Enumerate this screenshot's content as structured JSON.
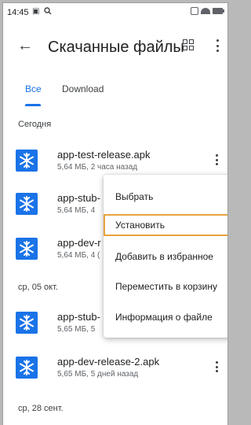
{
  "status_bar": {
    "time": "14:45",
    "left_icons": [
      "gallery-icon",
      "search-icon"
    ],
    "right_icons": [
      "vibrate-icon",
      "wifi-icon",
      "battery-icon"
    ]
  },
  "app_bar": {
    "title": "Скачанные файлы",
    "icons": [
      "back-arrow-icon",
      "grid-view-icon",
      "more-vert-icon"
    ]
  },
  "tabs": [
    {
      "label": "Все",
      "active": true
    },
    {
      "label": "Download",
      "active": false
    }
  ],
  "sections": [
    {
      "label": "Сегодня"
    },
    {
      "label": "ср, 05 окт."
    },
    {
      "label": "ср, 28 сент."
    }
  ],
  "files": [
    {
      "name": "app-test-release.apk",
      "meta": "5,64 МБ, 2 часа назад"
    },
    {
      "name": "app-stub-",
      "meta": "5,64 МБ, 4"
    },
    {
      "name": "app-dev-r",
      "meta": "5,64 МБ, 4 ("
    },
    {
      "name": "app-stub-",
      "meta": "5,65 МБ, 5"
    },
    {
      "name": "app-dev-release-2.apk",
      "meta": "5,65 МБ, 5 дней назад"
    }
  ],
  "context_menu": {
    "items": [
      {
        "label": "Выбрать"
      },
      {
        "label": "Установить",
        "highlighted": true
      },
      {
        "label": "Добавить в избранное"
      },
      {
        "label": "Переместить в корзину"
      },
      {
        "label": "Информация о файле"
      }
    ]
  },
  "colors": {
    "accent": "#1a73e8",
    "highlight_border": "#e8a33d"
  }
}
